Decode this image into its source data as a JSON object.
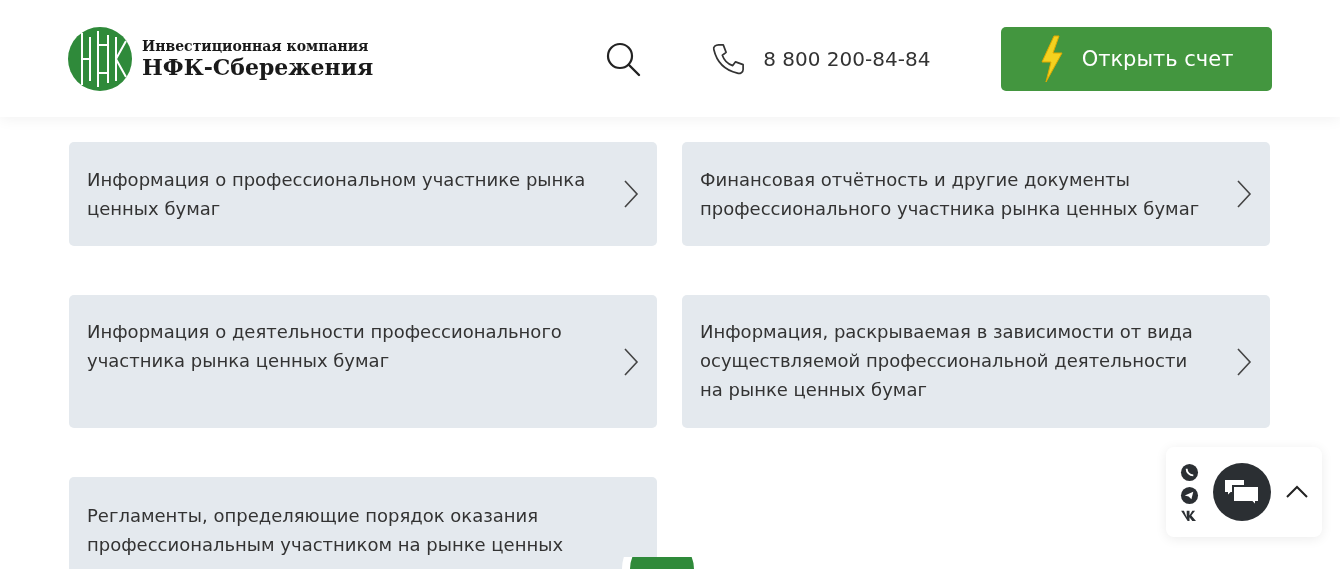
{
  "header": {
    "logo": {
      "tagline": "Инвестиционная компания",
      "name": "НФК-Сбережения"
    },
    "phone": "8 800 200-84-84",
    "open_account_button": "Открыть счет"
  },
  "cards": [
    {
      "text": "Информация о профессиональном участнике рынка ценных бумаг"
    },
    {
      "text": "Финансовая отчётность и другие документы профессионального участника рынка ценных бумаг"
    },
    {
      "text": "Информация о деятельности профессионального участника рынка ценных бумаг"
    },
    {
      "text": "Информация, раскрываемая в зависимости от вида осуществляемой профессиональной деятельности на рынке ценных бумаг"
    },
    {
      "text": "Регламенты, определяющие порядок оказания профессиональным участником на рынке ценных"
    }
  ]
}
